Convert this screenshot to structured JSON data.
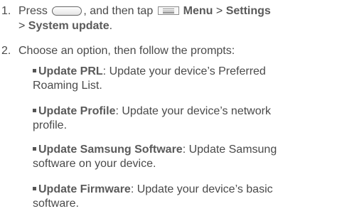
{
  "steps": [
    {
      "number": "1.",
      "before_button": "Press",
      "button_icon": "home-key-icon",
      "after_button": ", and then tap",
      "menu_icon": "menu-key-icon",
      "menu_label": "Menu",
      "arrow1": ">",
      "settings_label": "Settings",
      "arrow2": ">",
      "system_update_label": "System update",
      "period": "."
    },
    {
      "number": "2.",
      "text": "Choose an option, then follow the prompts:"
    }
  ],
  "options": [
    {
      "title": "Update PRL",
      "description_line1": ": Update your device’s Preferred",
      "description_line2": "Roaming List."
    },
    {
      "title": "Update Profile",
      "description_line1": ": Update your device’s network",
      "description_line2": "profile."
    },
    {
      "title": "Update Samsung Software",
      "description_line1": ": Update Samsung",
      "description_line2": "software on your device."
    },
    {
      "title": "Update Firmware",
      "description_line1": ": Update your device’s basic",
      "description_line2": "software."
    }
  ]
}
